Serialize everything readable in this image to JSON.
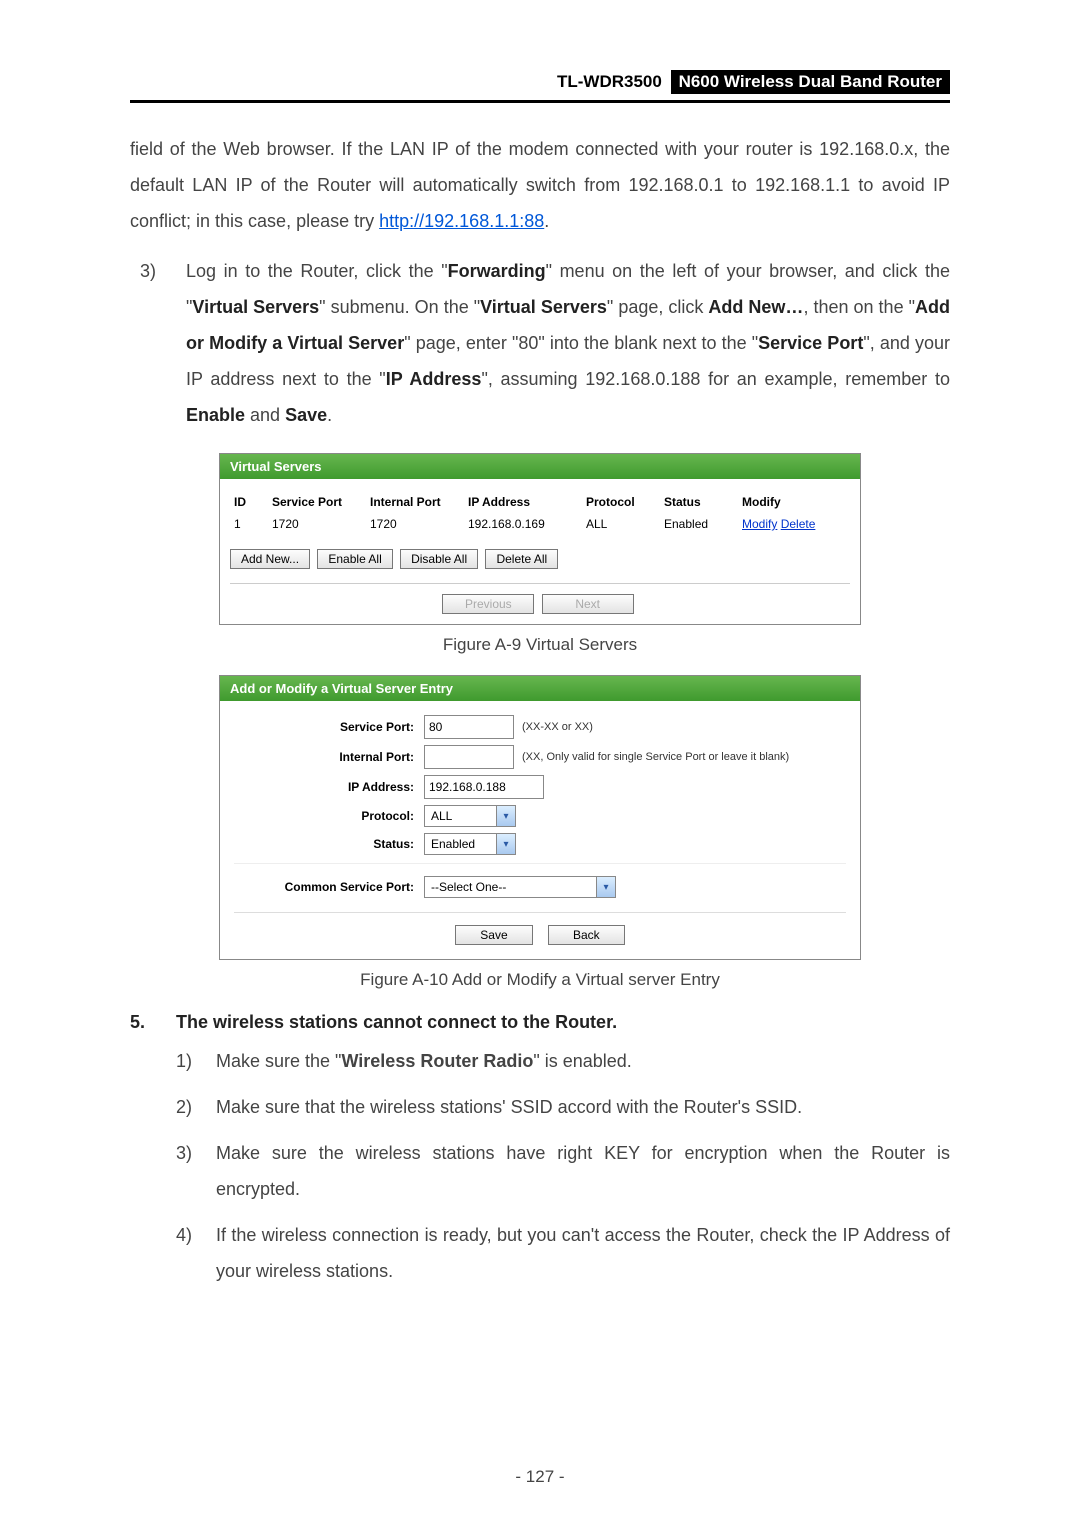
{
  "header": {
    "model": "TL-WDR3500",
    "product": "N600 Wireless Dual Band Router"
  },
  "intro_paragraph": {
    "text_before_link": "field of the Web browser. If the LAN IP of the modem connected with your router is 192.168.0.x, the default LAN IP of the Router will automatically switch from 192.168.0.1 to 192.168.1.1 to avoid IP conflict; in this case, please try ",
    "link": "http://192.168.1.1:88",
    "text_after_link": "."
  },
  "step3": {
    "marker": "3)",
    "seg1": "Log in to the Router, click the \"",
    "bold1": "Forwarding",
    "seg2": "\" menu on the left of your browser, and click the \"",
    "bold2": "Virtual Servers",
    "seg3": "\" submenu. On the \"",
    "bold3": "Virtual Servers",
    "seg4": "\" page, click ",
    "bold4": "Add New…",
    "seg5": ", then on the \"",
    "bold5": "Add or Modify a Virtual Server",
    "seg6": "\" page, enter \"80\" into the blank next to the \"",
    "bold6": "Service Port",
    "seg7": "\", and your IP address next to the \"",
    "bold7": "IP Address",
    "seg8": "\", assuming 192.168.0.188 for an example, remember to ",
    "bold8": "Enable",
    "seg9": " and ",
    "bold9": "Save",
    "seg10": "."
  },
  "virtual_servers": {
    "panel_title": "Virtual Servers",
    "columns": [
      "ID",
      "Service Port",
      "Internal Port",
      "IP Address",
      "Protocol",
      "Status",
      "Modify"
    ],
    "row": {
      "id": "1",
      "service_port": "1720",
      "internal_port": "1720",
      "ip_address": "192.168.0.169",
      "protocol": "ALL",
      "status": "Enabled",
      "modify_link": "Modify",
      "delete_link": "Delete"
    },
    "buttons": {
      "add_new": "Add New...",
      "enable_all": "Enable All",
      "disable_all": "Disable All",
      "delete_all": "Delete All",
      "previous": "Previous",
      "next": "Next"
    }
  },
  "caption_a9": "Figure A-9 Virtual Servers",
  "add_modify": {
    "panel_title": "Add or Modify a Virtual Server Entry",
    "labels": {
      "service_port": "Service Port:",
      "internal_port": "Internal Port:",
      "ip_address": "IP Address:",
      "protocol": "Protocol:",
      "status": "Status:",
      "common_service_port": "Common Service Port:"
    },
    "values": {
      "service_port": "80",
      "internal_port": "",
      "ip_address": "192.168.0.188",
      "protocol": "ALL",
      "status": "Enabled",
      "common_service_port": "--Select One--"
    },
    "hints": {
      "service_port": "(XX-XX or XX)",
      "internal_port": "(XX, Only valid for single Service Port or leave it blank)"
    },
    "buttons": {
      "save": "Save",
      "back": "Back"
    }
  },
  "caption_a10": "Figure A-10 Add or Modify a Virtual server Entry",
  "section5": {
    "num": "5.",
    "title": "The wireless stations cannot connect to the Router.",
    "items": [
      {
        "m": "1)",
        "pre": "Make sure the \"",
        "bold": "Wireless Router Radio",
        "post": "\" is enabled."
      },
      {
        "m": "2)",
        "text": "Make sure that the wireless stations' SSID accord with the Router's SSID."
      },
      {
        "m": "3)",
        "text": "Make sure the wireless stations have right KEY for encryption when the Router is encrypted."
      },
      {
        "m": "4)",
        "text": "If the wireless connection is ready, but you can't access the Router, check the IP Address of your wireless stations."
      }
    ]
  },
  "page_number": "- 127 -"
}
